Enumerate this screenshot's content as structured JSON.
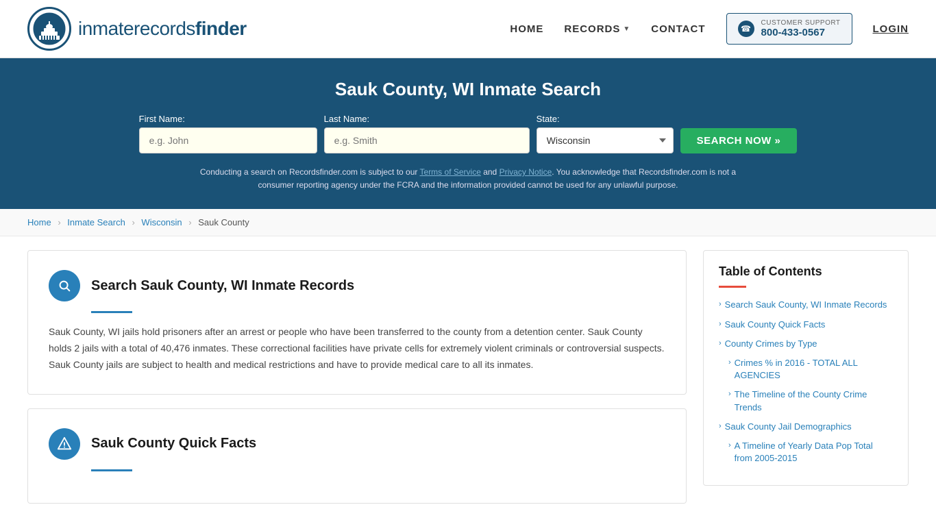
{
  "header": {
    "logo_text_light": "inmaterecords",
    "logo_text_bold": "finder",
    "nav": {
      "home": "HOME",
      "records": "RECORDS",
      "contact": "CONTACT",
      "login": "LOGIN"
    },
    "support": {
      "label": "CUSTOMER SUPPORT",
      "number": "800-433-0567"
    }
  },
  "hero": {
    "title": "Sauk County, WI Inmate Search",
    "form": {
      "first_name_label": "First Name:",
      "first_name_placeholder": "e.g. John",
      "last_name_label": "Last Name:",
      "last_name_placeholder": "e.g. Smith",
      "state_label": "State:",
      "state_value": "Wisconsin",
      "search_btn": "SEARCH NOW »"
    },
    "disclaimer": "Conducting a search on Recordsfinder.com is subject to our Terms of Service and Privacy Notice. You acknowledge that Recordsfinder.com is not a consumer reporting agency under the FCRA and the information provided cannot be used for any unlawful purpose."
  },
  "breadcrumb": {
    "items": [
      {
        "label": "Home",
        "link": true
      },
      {
        "label": "Inmate Search",
        "link": true
      },
      {
        "label": "Wisconsin",
        "link": true
      },
      {
        "label": "Sauk County",
        "link": false
      }
    ]
  },
  "main": {
    "section1": {
      "title": "Search Sauk County, WI Inmate Records",
      "body": "Sauk County, WI jails hold prisoners after an arrest or people who have been transferred to the county from a detention center. Sauk County holds 2 jails with a total of 40,476 inmates. These correctional facilities have private cells for extremely violent criminals or controversial suspects. Sauk County jails are subject to health and medical restrictions and have to provide medical care to all its inmates."
    },
    "section2": {
      "title": "Sauk County Quick Facts"
    }
  },
  "toc": {
    "title": "Table of Contents",
    "items": [
      {
        "label": "Search Sauk County, WI Inmate Records",
        "sub": false
      },
      {
        "label": "Sauk County Quick Facts",
        "sub": false
      },
      {
        "label": "County Crimes by Type",
        "sub": false
      },
      {
        "label": "Crimes % in 2016 - TOTAL ALL AGENCIES",
        "sub": true
      },
      {
        "label": "The Timeline of the County Crime Trends",
        "sub": true
      },
      {
        "label": "Sauk County Jail Demographics",
        "sub": false
      },
      {
        "label": "A Timeline of Yearly Data Pop Total from 2005-2015",
        "sub": true
      }
    ]
  }
}
